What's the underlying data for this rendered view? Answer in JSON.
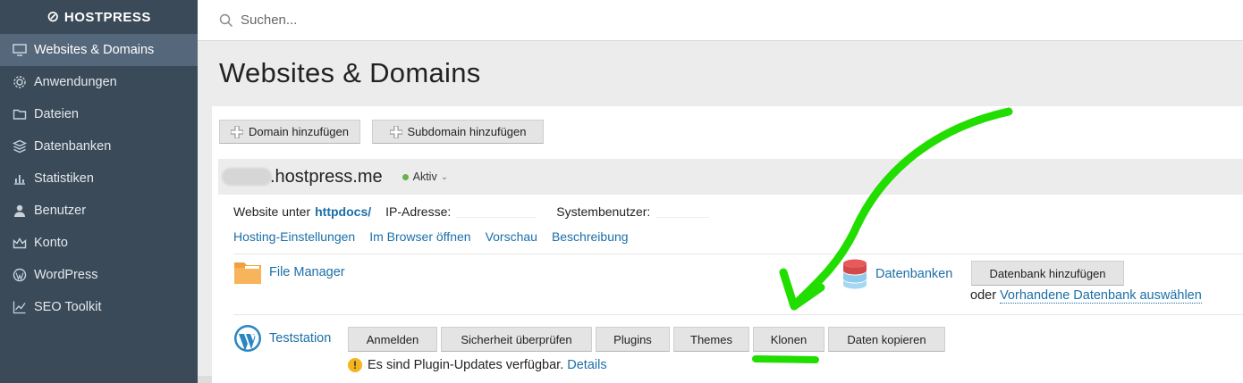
{
  "brand": {
    "name": "HOSTPRESS"
  },
  "sidebar": {
    "items": [
      {
        "label": "Websites & Domains",
        "icon": "monitor-icon",
        "active": true
      },
      {
        "label": "Anwendungen",
        "icon": "gear-icon"
      },
      {
        "label": "Dateien",
        "icon": "folder-icon"
      },
      {
        "label": "Datenbanken",
        "icon": "layers-icon"
      },
      {
        "label": "Statistiken",
        "icon": "bar-chart-icon"
      },
      {
        "label": "Benutzer",
        "icon": "user-icon"
      },
      {
        "label": "Konto",
        "icon": "crown-icon"
      },
      {
        "label": "WordPress",
        "icon": "wordpress-icon"
      },
      {
        "label": "SEO Toolkit",
        "icon": "trend-chart-icon"
      }
    ]
  },
  "search": {
    "placeholder": "Suchen..."
  },
  "page": {
    "title": "Websites & Domains"
  },
  "toolbar": {
    "add_domain": "Domain hinzufügen",
    "add_subdomain": "Subdomain hinzufügen"
  },
  "domain": {
    "name": ".hostpress.me",
    "status": "Aktiv",
    "website_prefix": "Website unter",
    "website_path": "httpdocs/",
    "ip_label": "IP-Adresse:",
    "sysuser_label": "Systembenutzer:",
    "links": [
      "Hosting-Einstellungen",
      "Im Browser öffnen",
      "Vorschau",
      "Beschreibung"
    ],
    "file_manager": "File Manager",
    "databases": "Datenbanken",
    "db_add": "Datenbank hinzufügen",
    "db_alt_prefix": "oder",
    "db_alt_link": "Vorhandene Datenbank auswählen",
    "wp_name": "Teststation",
    "wp_buttons": [
      "Anmelden",
      "Sicherheit überprüfen",
      "Plugins",
      "Themes",
      "Klonen",
      "Daten kopieren"
    ],
    "notice_text": "Es sind Plugin-Updates verfügbar.",
    "notice_link": "Details"
  },
  "colors": {
    "sidebar_bg": "#3b4a58",
    "sidebar_active": "#55677a",
    "link": "#1a6fa8",
    "status_green": "#6ab04c",
    "annotation_green": "#22dd00"
  }
}
